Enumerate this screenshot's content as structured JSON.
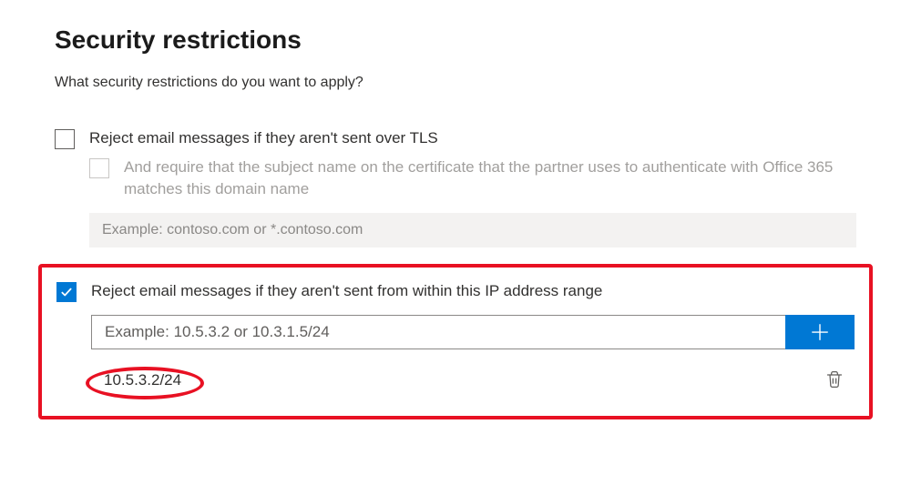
{
  "title": "Security restrictions",
  "intro": "What security restrictions do you want to apply?",
  "optionTls": {
    "label": "Reject email messages if they aren't sent over TLS",
    "checked": false
  },
  "optionTlsSub": {
    "label": "And require that the subject name on the certificate that the partner uses to authenticate with Office 365 matches this domain name",
    "placeholder": "Example: contoso.com or *.contoso.com"
  },
  "optionIp": {
    "label": "Reject email messages if they aren't sent from within this IP address range",
    "checked": true
  },
  "ipInput": {
    "placeholder": "Example: 10.5.3.2 or 10.3.1.5/24"
  },
  "ipList": [
    {
      "value": "10.5.3.2/24"
    }
  ]
}
